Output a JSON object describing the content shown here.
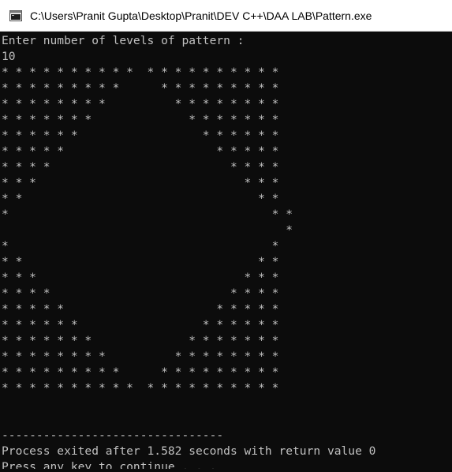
{
  "window": {
    "title": "C:\\Users\\Pranit Gupta\\Desktop\\Pranit\\DEV C++\\DAA LAB\\Pattern.exe",
    "icon": "console-app-icon",
    "background": "#0c0c0c",
    "text_color": "#c0c0c0"
  },
  "console": {
    "lines": [
      "Enter number of levels of pattern :",
      "10",
      "* * * * * * * * * *  * * * * * * * * * *",
      "* * * * * * * * *      * * * * * * * * *",
      "* * * * * * * *          * * * * * * * *",
      "* * * * * * *              * * * * * * *",
      "* * * * * *                  * * * * * *",
      "* * * * *                      * * * * *",
      "* * * *                          * * * *",
      "* * *                              * * *",
      "* *                                  * *",
      "*                                      * *",
      "                                         *",
      "*                                      *",
      "* *                                  * *",
      "* * *                              * * *",
      "* * * *                          * * * *",
      "* * * * *                      * * * * *",
      "* * * * * *                  * * * * * *",
      "* * * * * * *              * * * * * * *",
      "* * * * * * * *          * * * * * * * *",
      "* * * * * * * * *      * * * * * * * * *",
      "* * * * * * * * * *  * * * * * * * * * *",
      "",
      "",
      "--------------------------------",
      "Process exited after 1.582 seconds with return value 0",
      "Press any key to continue . . ."
    ]
  }
}
